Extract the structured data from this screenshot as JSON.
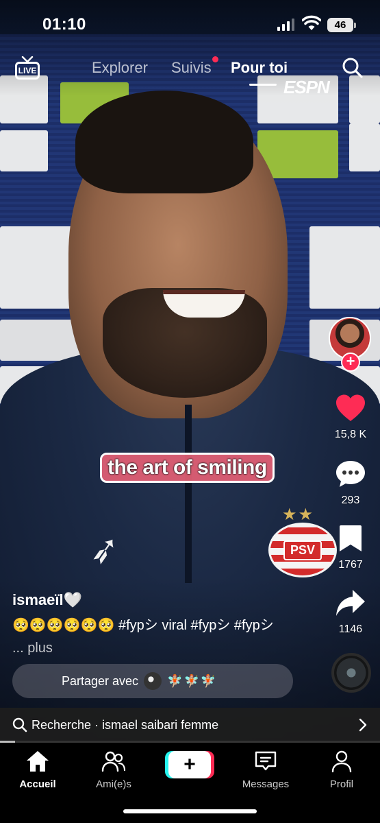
{
  "status_bar": {
    "time": "01:10",
    "battery": "46"
  },
  "top_nav": {
    "live_label": "LIVE",
    "tabs": [
      {
        "label": "Explorer"
      },
      {
        "label": "Suivis"
      },
      {
        "label": "Pour toi"
      }
    ],
    "active_tab": "Pour toi",
    "notification_dot_color": "#fe2c55"
  },
  "video": {
    "watermark": "ESPN",
    "caption_overlay": "the art of smiling",
    "badge": "PSV"
  },
  "right_rail": {
    "likes": "15,8 K",
    "comments": "293",
    "saves": "1767",
    "shares": "1146",
    "like_color": "#fe2c55",
    "follow_label": "+"
  },
  "post": {
    "username": "ismaeïl🤍",
    "description": "🥺🥺🥺🥺🥺🥺 #fypシ viral #fypシ #fypシ",
    "more_label": "... plus",
    "share_label": "Partager avec",
    "share_emojis": "🧚🏼🧚🏼🧚🏼"
  },
  "search_suggestion": {
    "text": "Recherche · ismael saibari femme",
    "progress": 0.04
  },
  "tab_bar": {
    "items": [
      {
        "label": "Accueil",
        "icon": "home-icon"
      },
      {
        "label": "Ami(e)s",
        "icon": "friends-icon"
      },
      {
        "label": "",
        "icon": "create-icon"
      },
      {
        "label": "Messages",
        "icon": "messages-icon"
      },
      {
        "label": "Profil",
        "icon": "profile-icon"
      }
    ],
    "active": "Accueil",
    "create_label": "+"
  }
}
